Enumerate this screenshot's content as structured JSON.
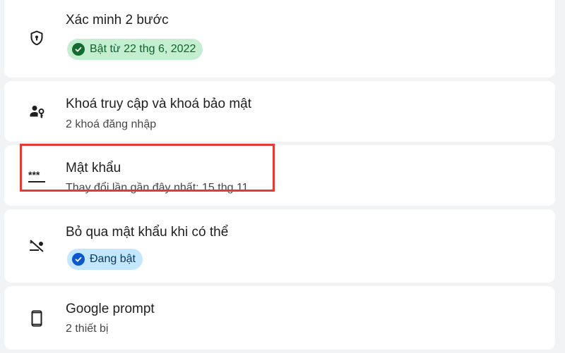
{
  "items": [
    {
      "title": "Xác minh 2 bước",
      "chip": "Bật từ 22 thg 6, 2022",
      "icon": "shield-lock-icon"
    },
    {
      "title": "Khoá truy cập và khoá bảo mật",
      "subtitle": "2 khoá đăng nhập",
      "icon": "person-key-icon"
    },
    {
      "title": "Mật khẩu",
      "subtitle": "Thay đổi lần gần đây nhất: 15 thg 11",
      "icon": "password-icon"
    },
    {
      "title": "Bỏ qua mật khẩu khi có thể",
      "chip": "Đang bật",
      "icon": "password-off-icon"
    },
    {
      "title": "Google prompt",
      "subtitle": "2 thiết bị",
      "icon": "phone-icon"
    }
  ],
  "colors": {
    "highlight": "#e53935",
    "chip_green_bg": "#c4eed0",
    "chip_blue_bg": "#c2e7ff"
  }
}
